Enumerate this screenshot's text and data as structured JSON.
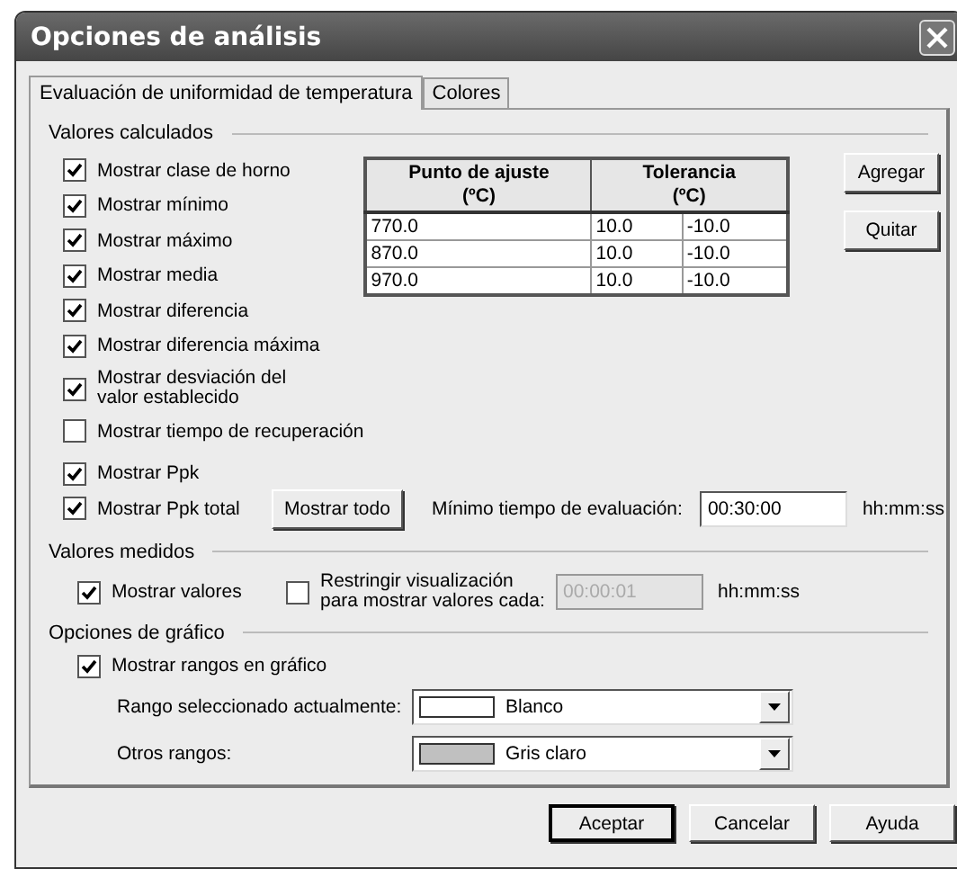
{
  "window": {
    "title": "Opciones de análisis"
  },
  "tabs": [
    {
      "label": "Evaluación de uniformidad de temperatura",
      "selected": true
    },
    {
      "label": "Colores",
      "selected": false
    }
  ],
  "calculated": {
    "title": "Valores calculados",
    "checkboxes": [
      {
        "label": "Mostrar clase de horno",
        "checked": true
      },
      {
        "label": "Mostrar mínimo",
        "checked": true
      },
      {
        "label": "Mostrar máximo",
        "checked": true
      },
      {
        "label": "Mostrar media",
        "checked": true
      },
      {
        "label": "Mostrar diferencia",
        "checked": true
      },
      {
        "label": "Mostrar diferencia máxima",
        "checked": true
      },
      {
        "label": "Mostrar desviación del valor establecido",
        "checked": true
      },
      {
        "label": "Mostrar tiempo de recuperación",
        "checked": false
      },
      {
        "label": "Mostrar Ppk",
        "checked": true
      },
      {
        "label": "Mostrar Ppk total",
        "checked": true
      }
    ],
    "table": {
      "setpoint_header": "Punto de ajuste (ºC)",
      "tolerance_header": "Tolerancia (ºC)",
      "rows": [
        {
          "setpoint": "770.0",
          "tolerance_plus": "10.0",
          "tolerance_minus": "-10.0"
        },
        {
          "setpoint": "870.0",
          "tolerance_plus": "10.0",
          "tolerance_minus": "-10.0"
        },
        {
          "setpoint": "970.0",
          "tolerance_plus": "10.0",
          "tolerance_minus": "-10.0"
        }
      ]
    },
    "side_buttons": [
      "Agregar",
      "Quitar"
    ],
    "show_all_button": "Mostrar todo",
    "min_time": {
      "label": "Mínimo tiempo de evaluación:",
      "value": "00:30:00",
      "unit": "hh:mm:ss"
    }
  },
  "measured": {
    "title": "Valores medidos",
    "show_values": {
      "label": "Mostrar valores",
      "checked": true
    },
    "restrict": {
      "label": "Restringir visualización para mostrar valores cada:",
      "checked": false
    },
    "interval": {
      "value": "00:00:01",
      "disabled": true,
      "unit": "hh:mm:ss"
    }
  },
  "chart_options": {
    "title": "Opciones de gráfico",
    "show_ranges": {
      "label": "Mostrar rangos en gráfico",
      "checked": true
    },
    "combos": [
      {
        "label": "Rango seleccionado actualmente:",
        "value": "Blanco",
        "color": "#ffffff"
      },
      {
        "label": "Otros rangos:",
        "value": "Gris claro",
        "color": "#c0c0c0"
      }
    ]
  },
  "buttons": [
    {
      "label": "Aceptar",
      "default": true
    },
    {
      "label": "Cancelar",
      "default": false
    },
    {
      "label": "Ayuda",
      "default": false
    }
  ]
}
